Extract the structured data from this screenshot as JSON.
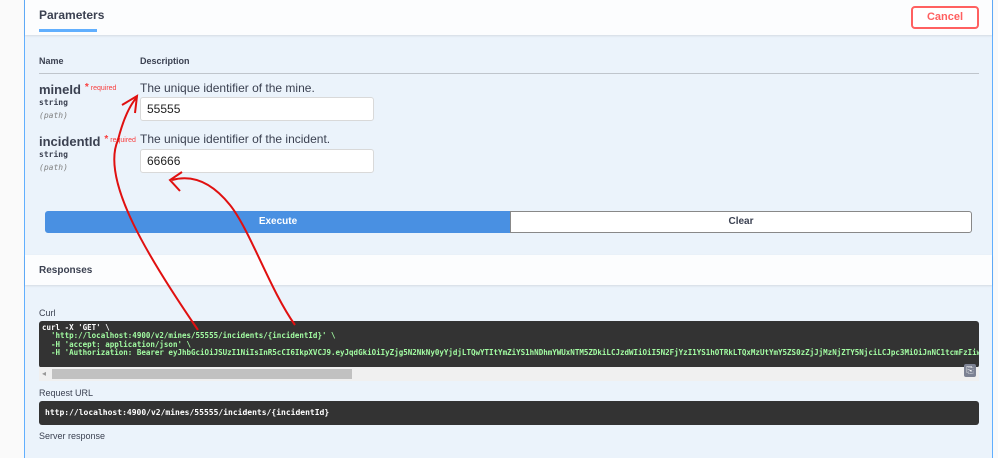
{
  "tabs": {
    "parameters": "Parameters",
    "cancel": "Cancel"
  },
  "table": {
    "name_header": "Name",
    "description_header": "Description"
  },
  "params": [
    {
      "name": "mineId",
      "required_star": "*",
      "required": "required",
      "type": "string",
      "in": "(path)",
      "description": "The unique identifier of the mine.",
      "value": "55555"
    },
    {
      "name": "incidentId",
      "required_star": "*",
      "required": "required",
      "type": "string",
      "in": "(path)",
      "description": "The unique identifier of the incident.",
      "value": "66666"
    }
  ],
  "buttons": {
    "execute": "Execute",
    "clear": "Clear"
  },
  "responses": {
    "title": "Responses",
    "curl_label": "Curl",
    "curl_line1": "curl -X 'GET' \\",
    "curl_line2": "  'http://localhost:4900/v2/mines/55555/incidents/{incidentId}' \\",
    "curl_line3": "  -H 'accept: application/json' \\",
    "curl_line4": "  -H 'Authorization: Bearer eyJhbGciOiJSUzI1NiIsInR5cCI6IkpXVCJ9.eyJqdGkiOiIyZjg5N2NkNy0yYjdjLTQwYTItYmZiYS1hNDhmYWUxNTM5ZDkiLCJzdWIiOiI5N2FjYzI1YS1hOTRkLTQxMzUtYmY5ZS0zZjJjMzNjZTY5NjciLCJpc3MiOiJnNC1tcmFzIiw",
    "request_url_label": "Request URL",
    "request_url": "http://localhost:4900/v2/mines/55555/incidents/{incidentId}",
    "server_response_label": "Server response"
  },
  "colors": {
    "accent": "#61affe",
    "execute": "#4990e2",
    "cancel": "#ff6060",
    "annotation": "#e01010"
  }
}
